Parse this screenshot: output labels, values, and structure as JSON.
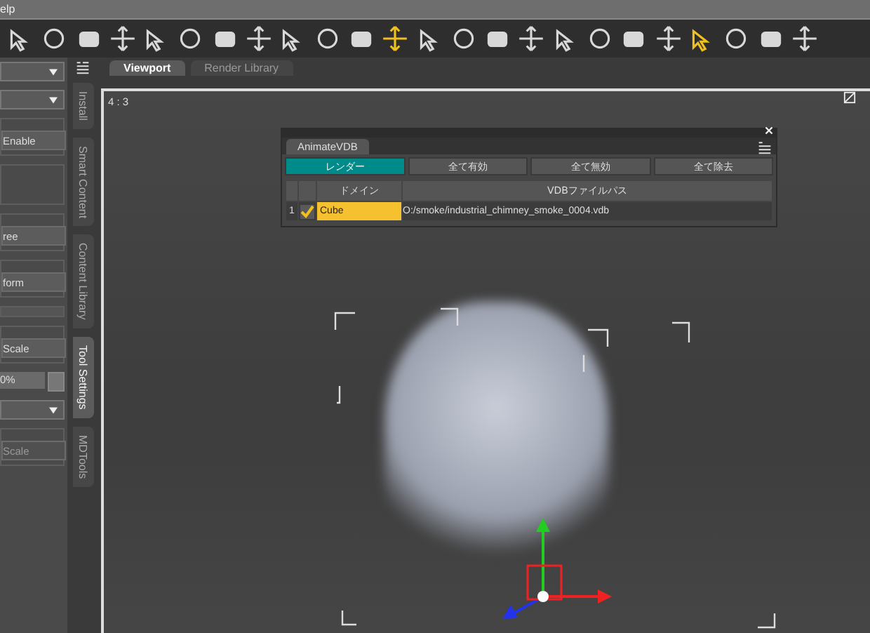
{
  "menu_bar": {
    "items": [
      "elp"
    ]
  },
  "toolbar": {
    "tools": [
      {
        "selected": false
      },
      {
        "selected": false
      },
      {
        "selected": false
      },
      {
        "selected": false
      },
      {
        "selected": false
      },
      {
        "selected": false
      },
      {
        "selected": false
      },
      {
        "selected": false
      },
      {
        "selected": false
      },
      {
        "selected": false
      },
      {
        "selected": false
      },
      {
        "selected": true
      },
      {
        "selected": false
      },
      {
        "selected": false
      },
      {
        "selected": false
      },
      {
        "selected": false
      },
      {
        "selected": false
      },
      {
        "selected": false
      },
      {
        "selected": false
      },
      {
        "selected": false
      },
      {
        "selected": true
      },
      {
        "selected": false
      },
      {
        "selected": false
      },
      {
        "selected": false
      }
    ]
  },
  "left_panel": {
    "items": [
      {
        "kind": "dropdown"
      },
      {
        "kind": "dropdown"
      },
      {
        "kind": "button",
        "label": "Enable",
        "disabled": false
      },
      {
        "kind": "group"
      },
      {
        "kind": "button",
        "label": "ree",
        "disabled": false
      },
      {
        "kind": "button",
        "label": "form",
        "disabled": false
      },
      {
        "kind": "bar"
      },
      {
        "kind": "button",
        "label": "Scale",
        "disabled": false
      },
      {
        "kind": "spin",
        "value": "0%"
      },
      {
        "kind": "dropdown"
      },
      {
        "kind": "button",
        "label": "Scale",
        "disabled": true
      }
    ]
  },
  "side_tabs": [
    {
      "label": "Install",
      "selected": false
    },
    {
      "label": "Smart Content",
      "selected": false
    },
    {
      "label": "Content Library",
      "selected": false
    },
    {
      "label": "Tool Settings",
      "selected": true
    },
    {
      "label": "MDTools",
      "selected": false
    }
  ],
  "view_tabs": [
    {
      "label": "Viewport",
      "selected": true
    },
    {
      "label": "Render Library",
      "selected": false
    }
  ],
  "viewport": {
    "aspect": "4 : 3"
  },
  "dialog": {
    "tab": "AnimateVDB",
    "buttons": [
      {
        "label": "レンダー",
        "selected": true
      },
      {
        "label": "全て有効",
        "selected": false
      },
      {
        "label": "全て無効",
        "selected": false
      },
      {
        "label": "全て除去",
        "selected": false
      }
    ],
    "columns": [
      "ドメイン",
      "VDBファイルパス"
    ],
    "rows": [
      {
        "index": "1",
        "checked": true,
        "domain": "Cube",
        "path": "O:/smoke/industrial_chimney_smoke_0004.vdb"
      }
    ]
  }
}
